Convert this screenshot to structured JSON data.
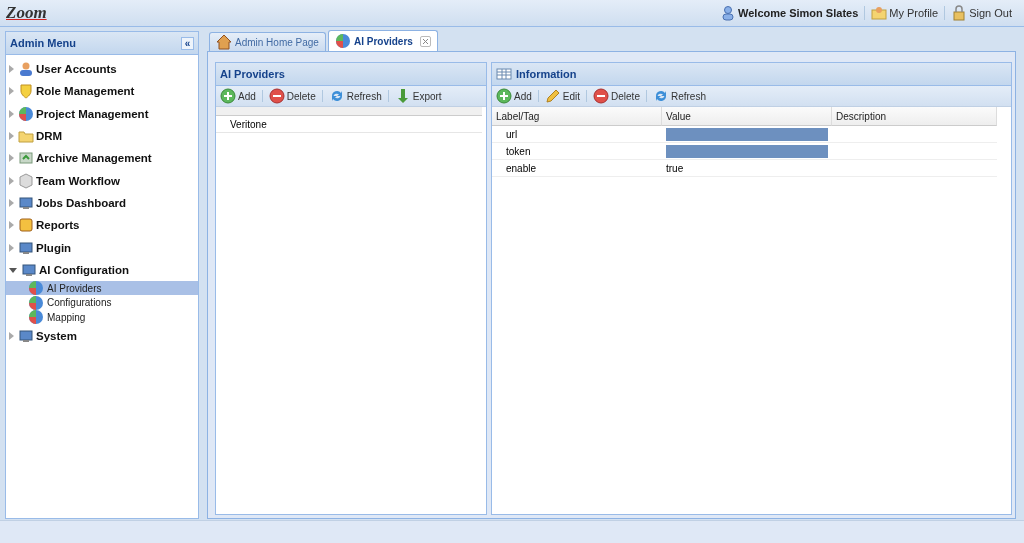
{
  "header": {
    "logo": "Zoom",
    "welcome": "Welcome Simon Slates",
    "links": [
      "My Profile",
      "Sign Out"
    ]
  },
  "admin_menu": {
    "title": "Admin Menu",
    "collapse": "«",
    "items": [
      {
        "label": "User Accounts",
        "expanded": false
      },
      {
        "label": "Role Management",
        "expanded": false
      },
      {
        "label": "Project Management",
        "expanded": false
      },
      {
        "label": "DRM",
        "expanded": false
      },
      {
        "label": "Archive Management",
        "expanded": false
      },
      {
        "label": "Team Workflow",
        "expanded": false
      },
      {
        "label": "Jobs Dashboard",
        "expanded": false
      },
      {
        "label": "Reports",
        "expanded": false
      },
      {
        "label": "Plugin",
        "expanded": false
      },
      {
        "label": "AI Configuration",
        "expanded": true,
        "children": [
          {
            "label": "AI Providers",
            "selected": true
          },
          {
            "label": "Configurations",
            "selected": false
          },
          {
            "label": "Mapping",
            "selected": false
          }
        ]
      },
      {
        "label": "System",
        "expanded": false
      }
    ]
  },
  "tabs": [
    {
      "label": "Admin Home Page",
      "selected": false,
      "closable": false
    },
    {
      "label": "AI Providers",
      "selected": true,
      "closable": true
    }
  ],
  "providers_panel": {
    "title": "AI Providers",
    "toolbar": [
      "Add",
      "Delete",
      "Refresh",
      "Export"
    ],
    "rows": [
      {
        "name": "Veritone"
      }
    ]
  },
  "information_panel": {
    "title": "Information",
    "toolbar": [
      "Add",
      "Edit",
      "Delete",
      "Refresh"
    ],
    "columns": [
      "Label/Tag",
      "Value",
      "Description"
    ],
    "rows": [
      {
        "label": "url",
        "value": {
          "kind": "redacted"
        }
      },
      {
        "label": "token",
        "value": {
          "kind": "redacted"
        }
      },
      {
        "label": "enable",
        "value": {
          "kind": "text",
          "text": "true"
        }
      }
    ]
  }
}
